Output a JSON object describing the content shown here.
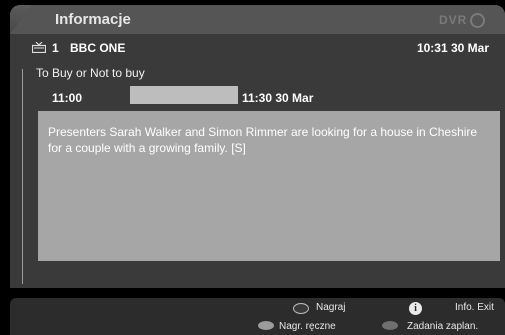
{
  "window": {
    "title": "Informacje",
    "logo_text": "DVR"
  },
  "channel": {
    "number": "1",
    "name": "BBC ONE",
    "clock": "10:31 30 Mar"
  },
  "program": {
    "title": "To Buy or Not to buy",
    "start_time": "11:00",
    "end_time": "11:30 30 Mar",
    "progress_fraction": 0.0,
    "description": "Presenters Sarah Walker and Simon Rimmer are looking for a house in Cheshire for a couple with a growing family. [S]"
  },
  "footer": {
    "record_label": "Nagraj",
    "info_exit_label": "Info. Exit",
    "manual_record_label": "Nagr. ręczne",
    "schedule_label": "Zadania zaplan.",
    "icons": {
      "record": "circle-button-icon",
      "info": "info-icon",
      "manual_record": "grey-oval-button-icon",
      "schedule": "grey-oval-button-icon"
    }
  }
}
